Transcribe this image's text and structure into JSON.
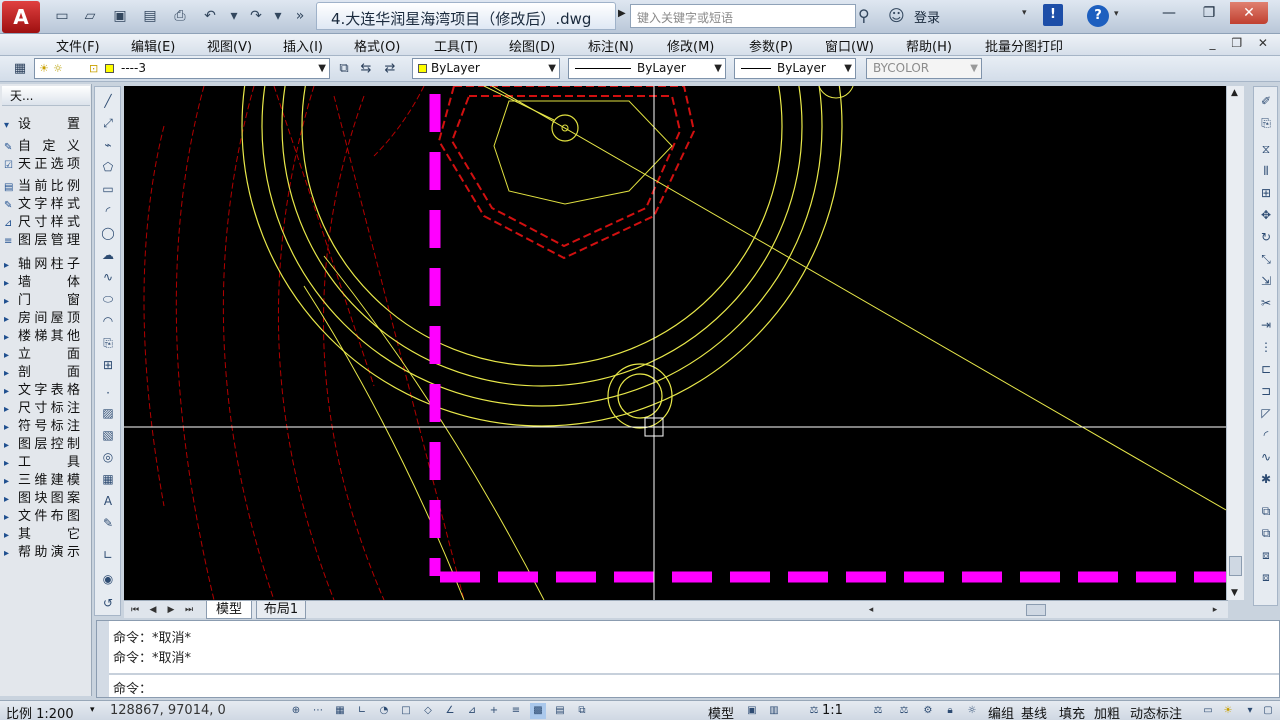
{
  "titlebar": {
    "logo": "A",
    "doc_title": "4.大连华润星海湾项目（修改后）.dwg",
    "search_placeholder": "键入关键字或短语",
    "login_label": "登录",
    "exchange_label": "!",
    "help_label": "?",
    "minimize": "—",
    "restore": "❐",
    "close": "✕"
  },
  "menu": {
    "items": [
      "文件(F)",
      "编辑(E)",
      "视图(V)",
      "插入(I)",
      "格式(O)",
      "工具(T)",
      "绘图(D)",
      "标注(N)",
      "修改(M)",
      "参数(P)",
      "窗口(W)",
      "帮助(H)",
      "批量分图打印"
    ],
    "window_controls": "_ ❐ ✕"
  },
  "properties": {
    "layer_value": "----3",
    "color_value": "ByLayer",
    "linetype_value": "ByLayer",
    "lineweight_value": "ByLayer",
    "plotstyle_value": "BYCOLOR"
  },
  "palette": {
    "title": "天...",
    "items": [
      {
        "label": "设　　置",
        "icon": "▾"
      },
      {
        "label": "自 定 义",
        "icon": "✎"
      },
      {
        "label": "天正选项",
        "icon": "☑"
      },
      {
        "label": "当前比例",
        "icon": "▤"
      },
      {
        "label": "文字样式",
        "icon": "✎"
      },
      {
        "label": "尺寸样式",
        "icon": "⊿"
      },
      {
        "label": "图层管理",
        "icon": "≡"
      },
      {
        "label": "轴网柱子",
        "icon": "▸"
      },
      {
        "label": "墙　　体",
        "icon": "▸"
      },
      {
        "label": "门　　窗",
        "icon": "▸"
      },
      {
        "label": "房间屋顶",
        "icon": "▸"
      },
      {
        "label": "楼梯其他",
        "icon": "▸"
      },
      {
        "label": "立　　面",
        "icon": "▸"
      },
      {
        "label": "剖　　面",
        "icon": "▸"
      },
      {
        "label": "文字表格",
        "icon": "▸"
      },
      {
        "label": "尺寸标注",
        "icon": "▸"
      },
      {
        "label": "符号标注",
        "icon": "▸"
      },
      {
        "label": "图层控制",
        "icon": "▸"
      },
      {
        "label": "工　　具",
        "icon": "▸"
      },
      {
        "label": "三维建模",
        "icon": "▸"
      },
      {
        "label": "图块图案",
        "icon": "▸"
      },
      {
        "label": "文件布图",
        "icon": "▸"
      },
      {
        "label": "其　　它",
        "icon": "▸"
      },
      {
        "label": "帮助演示",
        "icon": "▸"
      }
    ]
  },
  "layout_tabs": {
    "model": "模型",
    "layout1": "布局1"
  },
  "command": {
    "history": [
      "命令：*取消*",
      "命令：*取消*"
    ],
    "prompt": "命令："
  },
  "status": {
    "scale": "比例 1:200",
    "coords": "128867, 97014, 0",
    "model_label": "模型",
    "annotation_scale": "1:1",
    "edit_label": "编组",
    "baseline_label": "基线",
    "fill_label": "填充",
    "bold_label": "加粗",
    "dynamic_label": "动态标注"
  },
  "colors": {
    "canvas": "#000000",
    "wall": "#ff00ff",
    "yellow_lines": "#ffff00",
    "red_lines": "#cc0000",
    "crosshair": "#ffffff"
  }
}
